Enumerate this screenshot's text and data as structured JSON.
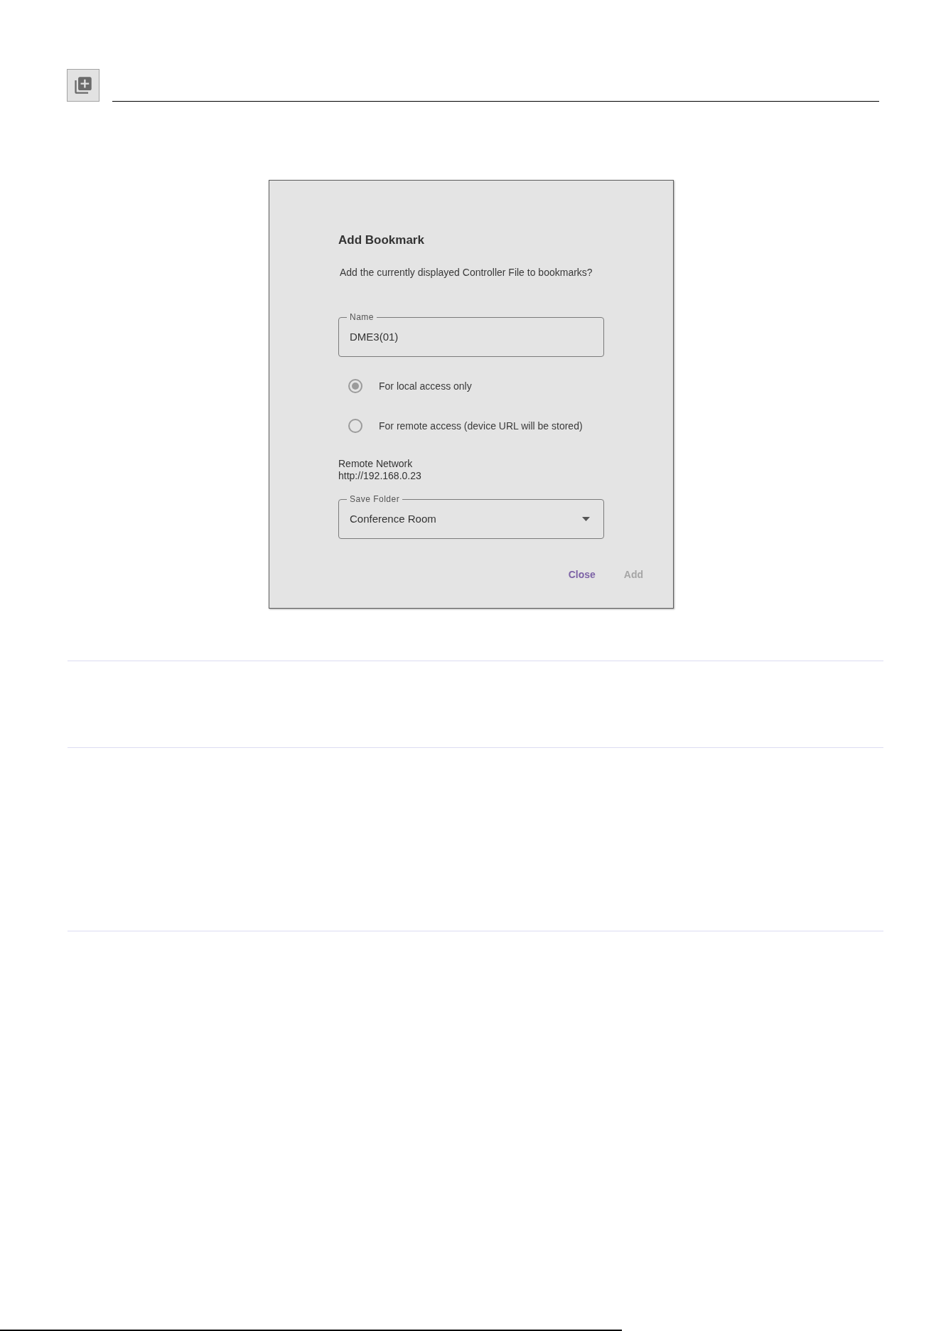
{
  "dialog": {
    "title": "Add Bookmark",
    "message": "Add the currently displayed Controller File to bookmarks?",
    "name_field": {
      "label": "Name",
      "value": "DME3(01)"
    },
    "access_options": [
      {
        "label": "For local access only",
        "selected": true
      },
      {
        "label": "For remote access (device URL will be stored)",
        "selected": false
      }
    ],
    "remote_network": {
      "label": "Remote Network",
      "url": "http://192.168.0.23"
    },
    "save_folder": {
      "label": "Save Folder",
      "value": "Conference Room"
    },
    "buttons": [
      {
        "label": "Close",
        "disabled": false
      },
      {
        "label": "Add",
        "disabled": true
      }
    ]
  }
}
